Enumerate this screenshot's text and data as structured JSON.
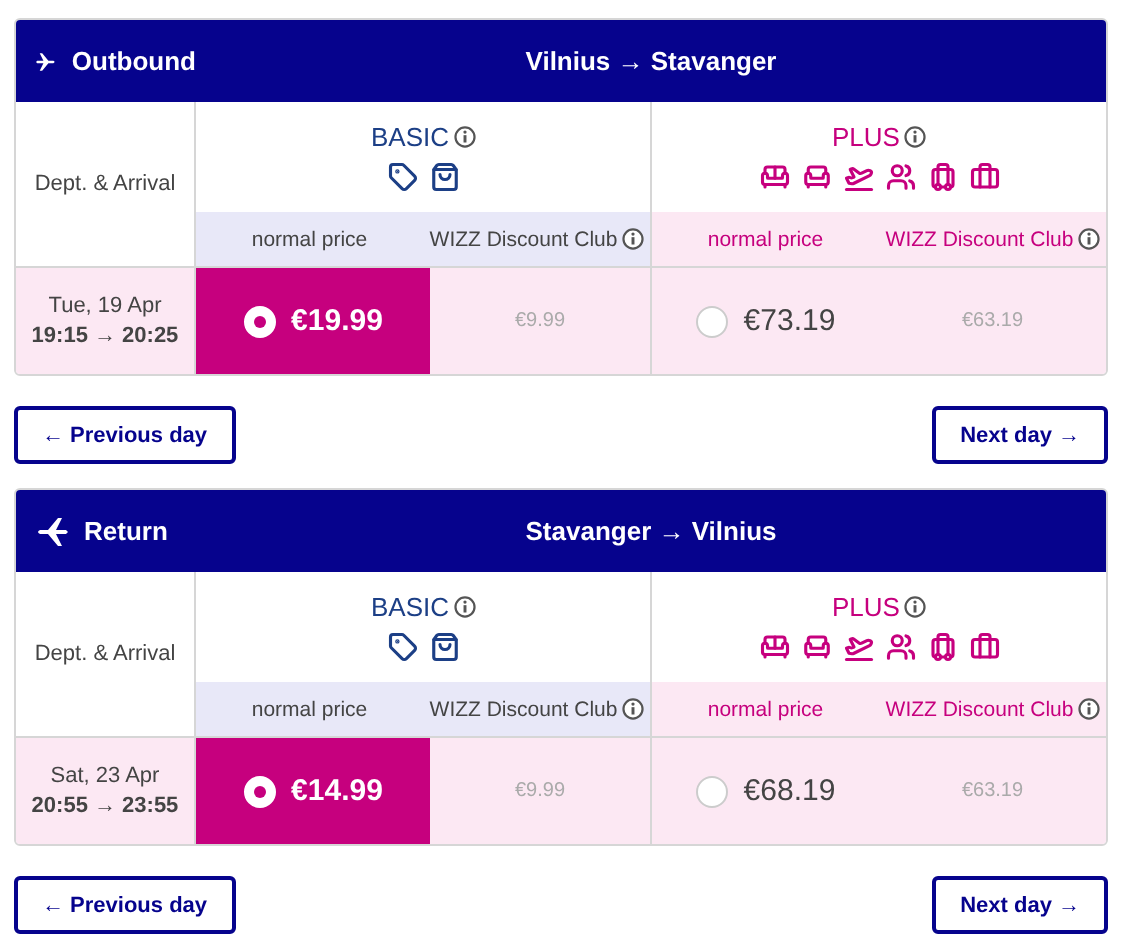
{
  "legs": [
    {
      "kind": "outbound",
      "label": "Outbound",
      "route": "Vilnius → Stavanger",
      "dept_label": "Dept. & Arrival",
      "date": "Tue, 19 Apr",
      "times": "19:15 → 20:25",
      "fares": [
        {
          "kind": "basic",
          "name": "BASIC",
          "normal_label": "normal price",
          "club_label": "WIZZ Discount Club",
          "price": "€19.99",
          "club_price": "€9.99",
          "selected": true
        },
        {
          "kind": "plus",
          "name": "PLUS",
          "normal_label": "normal price",
          "club_label": "WIZZ Discount Club",
          "price": "€73.19",
          "club_price": "€63.19",
          "selected": false
        }
      ],
      "prev": "← Previous day",
      "next": "Next day →"
    },
    {
      "kind": "return",
      "label": "Return",
      "route": "Stavanger → Vilnius",
      "dept_label": "Dept. & Arrival",
      "date": "Sat, 23 Apr",
      "times": "20:55 → 23:55",
      "fares": [
        {
          "kind": "basic",
          "name": "BASIC",
          "normal_label": "normal price",
          "club_label": "WIZZ Discount Club",
          "price": "€14.99",
          "club_price": "€9.99",
          "selected": true
        },
        {
          "kind": "plus",
          "name": "PLUS",
          "normal_label": "normal price",
          "club_label": "WIZZ Discount Club",
          "price": "€68.19",
          "club_price": "€63.19",
          "selected": false
        }
      ],
      "prev": "← Previous day",
      "next": "Next day →"
    }
  ]
}
